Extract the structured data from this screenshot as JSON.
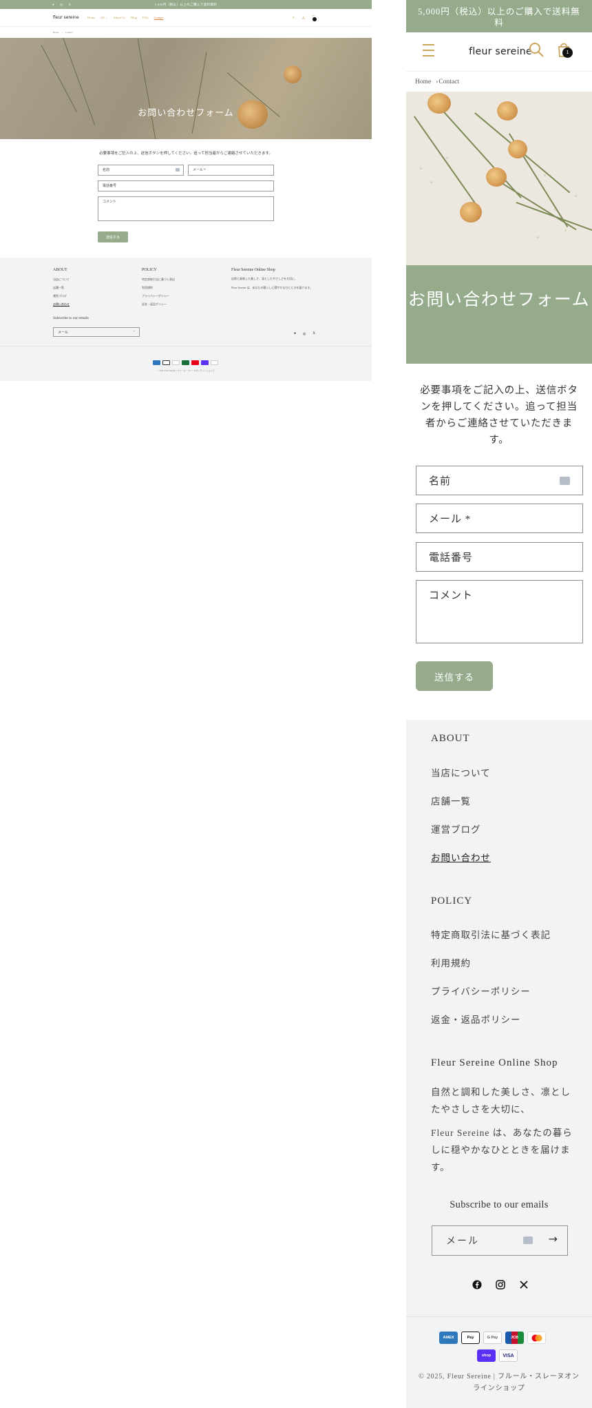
{
  "announcement": "5,000円（税込）以上のご購入で送料無料",
  "brand": {
    "logo": "fleur sereine",
    "accent": "#95ab8c",
    "icon_color": "#c9a55b"
  },
  "nav": {
    "items": [
      "Home",
      "All",
      "About Us",
      "Blog",
      "FAQ",
      "Contact"
    ],
    "active": "Contact"
  },
  "header_icons": [
    "menu-icon",
    "search-icon",
    "account-icon",
    "cart-icon"
  ],
  "cart_count": "1",
  "breadcrumb": {
    "home": "Home",
    "current": "Contact"
  },
  "page": {
    "title": "お問い合わせフォーム",
    "intro": "必要事項をご記入の上、送信ボタンを押してください。追って担当者からご連絡させていただきます。"
  },
  "form": {
    "name_label": "名前",
    "email_label": "メール *",
    "phone_label": "電話番号",
    "comment_label": "コメント",
    "submit_label": "送信する"
  },
  "footer": {
    "about_heading": "ABOUT",
    "about_links": [
      "当店について",
      "店舗一覧",
      "運営ブログ",
      "お問い合わせ"
    ],
    "policy_heading": "POLICY",
    "policy_links": [
      "特定商取引法に基づく表記",
      "利用規約",
      "プライバシーポリシー",
      "返金・返品ポリシー"
    ],
    "shop_heading": "Fleur Sereine Online Shop",
    "shop_text_1": "自然と調和した美しさ、凛としたやさしさを大切に、",
    "shop_text_2": "Fleur Sereine は、あなたの暮らしに穏やかなひとときを届けます。",
    "subscribe_heading": "Subscribe to our emails",
    "email_placeholder": "メール",
    "social": [
      "facebook-icon",
      "instagram-icon",
      "x-icon"
    ],
    "payments": [
      "American Express",
      "Apple Pay",
      "Google Pay",
      "JCB",
      "Mastercard",
      "Shop Pay",
      "Visa"
    ],
    "copyright": "© 2025, Fleur Sereine | フルール・スレーヌオンラインショップ"
  }
}
